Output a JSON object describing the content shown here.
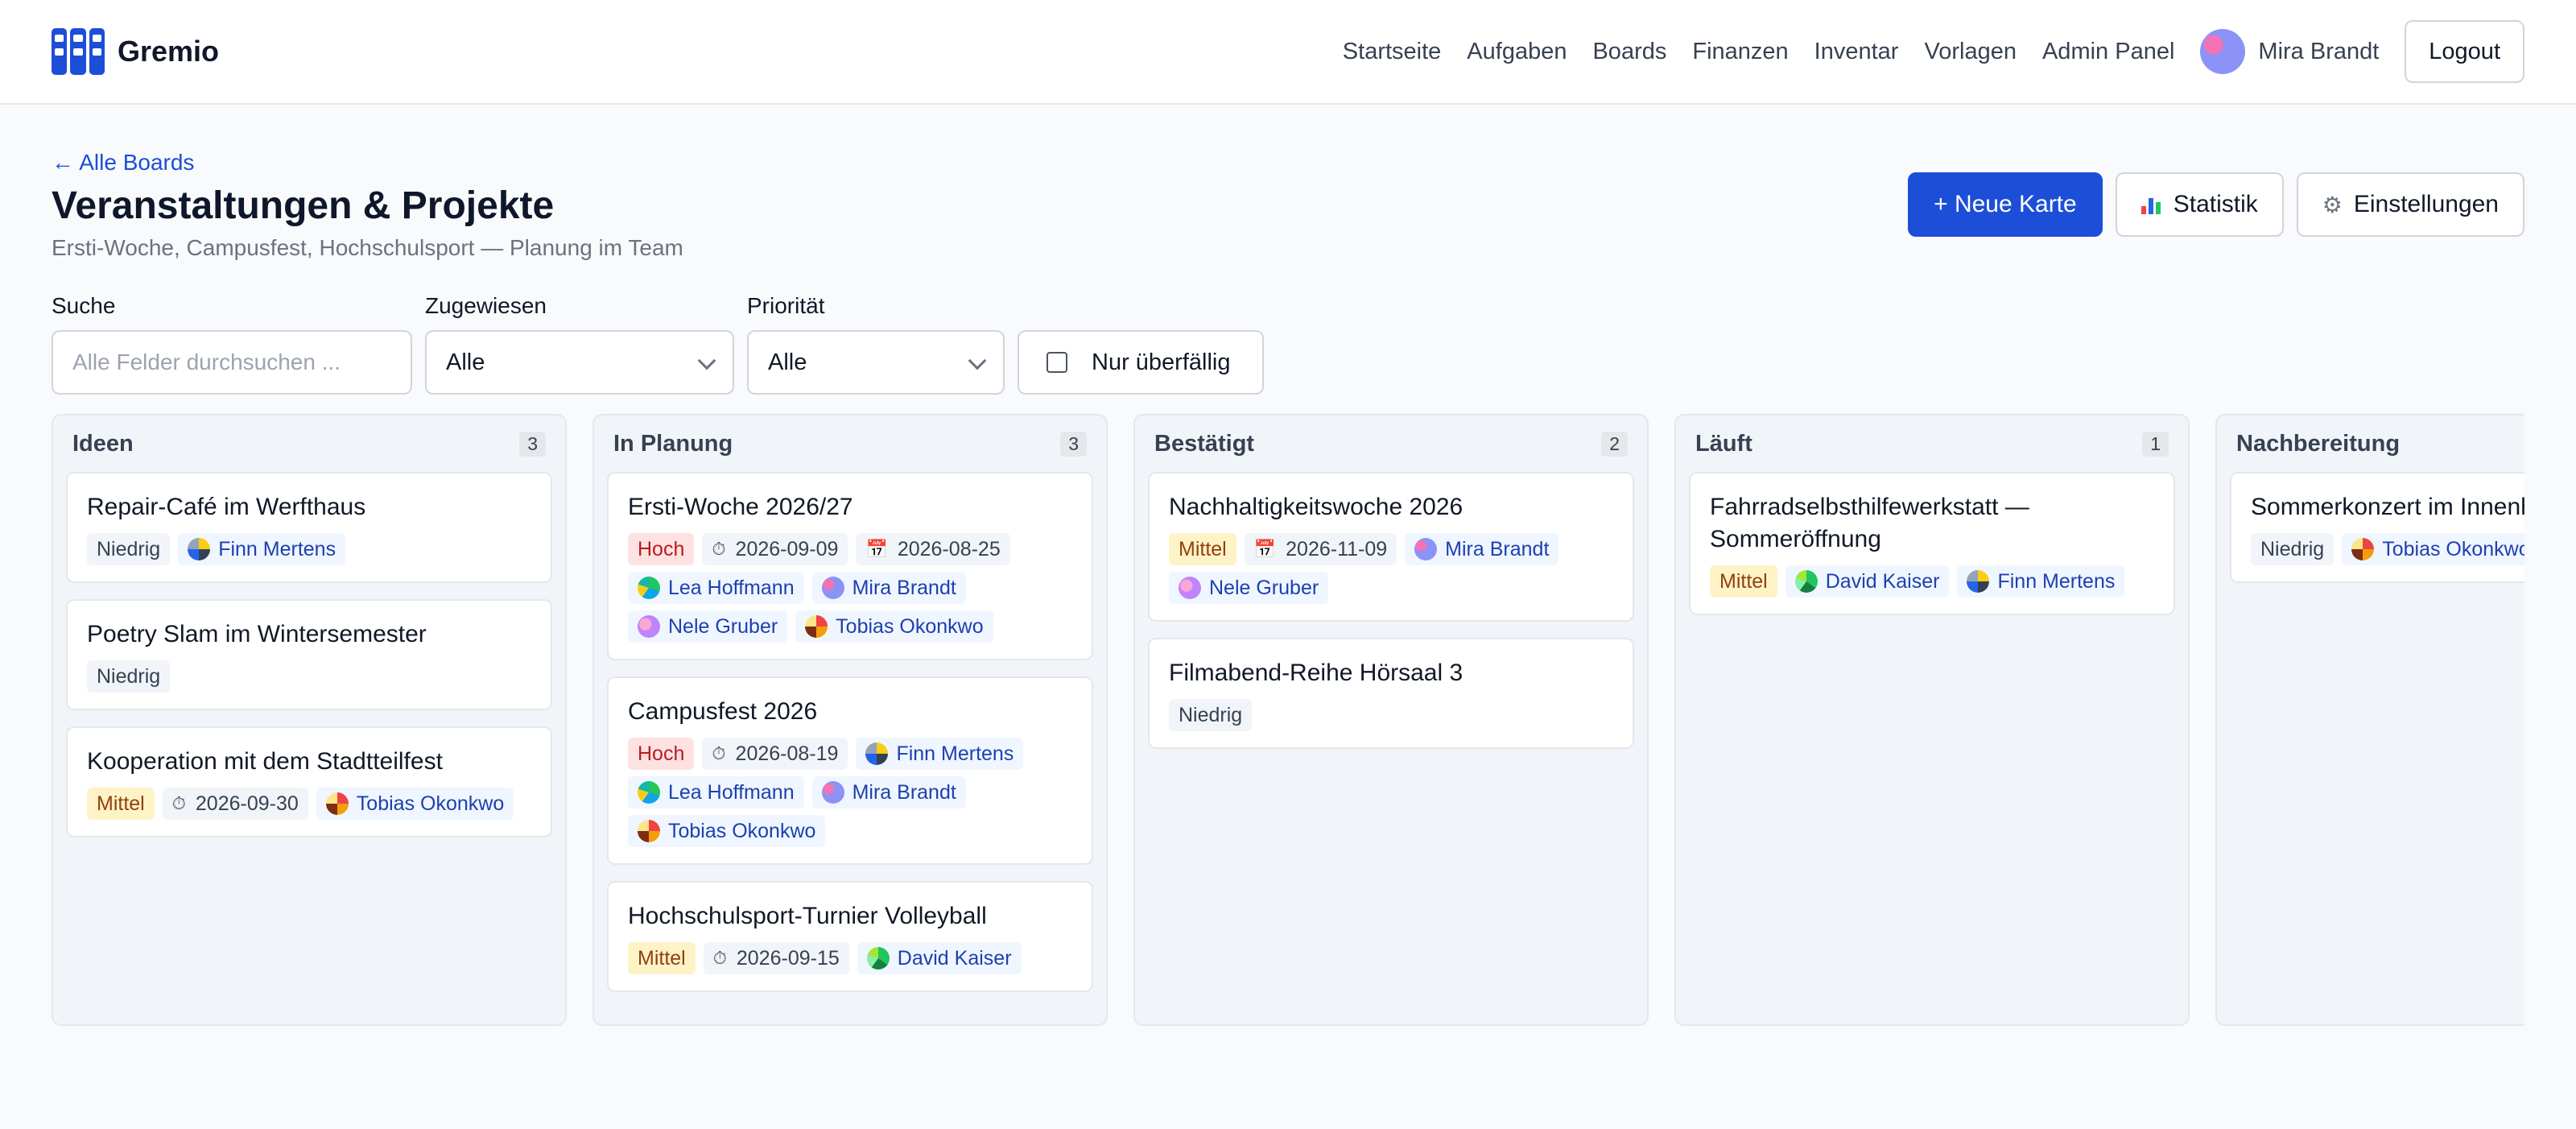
{
  "app": {
    "name": "Gremio"
  },
  "nav": {
    "links": [
      "Startseite",
      "Aufgaben",
      "Boards",
      "Finanzen",
      "Inventar",
      "Vorlagen",
      "Admin Panel"
    ],
    "user": "Mira Brandt",
    "logout": "Logout"
  },
  "page": {
    "back": "← Alle Boards",
    "title": "Veranstaltungen & Projekte",
    "subtitle": "Ersti-Woche, Campusfest, Hochschulsport — Planung im Team"
  },
  "actions": {
    "new_card": "+ Neue Karte",
    "stats": "Statistik",
    "settings": "Einstellungen"
  },
  "filters": {
    "search_label": "Suche",
    "search_placeholder": "Alle Felder durchsuchen ...",
    "assigned_label": "Zugewiesen",
    "assigned_value": "Alle",
    "priority_label": "Priorität",
    "priority_value": "Alle",
    "overdue_label": "Nur überfällig"
  },
  "colors": {
    "accent": "#1d4ed8",
    "column_bg": "#f1f5f9"
  },
  "icons": {
    "due": "timer-icon",
    "start": "calendar-icon"
  },
  "columns": [
    {
      "title": "Ideen",
      "count": "3",
      "cards": [
        {
          "title": "Repair-Café im Werfthaus",
          "priority": "Niedrig",
          "people": [
            "Finn Mertens"
          ]
        },
        {
          "title": "Poetry Slam im Wintersemester",
          "priority": "Niedrig",
          "people": []
        },
        {
          "title": "Kooperation mit dem Stadtteilfest",
          "priority": "Mittel",
          "due": "2026-09-30",
          "people": [
            "Tobias Okonkwo"
          ]
        }
      ]
    },
    {
      "title": "In Planung",
      "count": "3",
      "cards": [
        {
          "title": "Ersti-Woche 2026/27",
          "priority": "Hoch",
          "due": "2026-09-09",
          "start": "2026-08-25",
          "people": [
            "Lea Hoffmann",
            "Mira Brandt",
            "Nele Gruber",
            "Tobias Okonkwo"
          ]
        },
        {
          "title": "Campusfest 2026",
          "priority": "Hoch",
          "due": "2026-08-19",
          "people": [
            "Finn Mertens",
            "Lea Hoffmann",
            "Mira Brandt",
            "Tobias Okonkwo"
          ]
        },
        {
          "title": "Hochschulsport-Turnier Volleyball",
          "priority": "Mittel",
          "due": "2026-09-15",
          "people": [
            "David Kaiser"
          ]
        }
      ]
    },
    {
      "title": "Bestätigt",
      "count": "2",
      "cards": [
        {
          "title": "Nachhaltigkeitswoche 2026",
          "priority": "Mittel",
          "start": "2026-11-09",
          "people": [
            "Mira Brandt",
            "Nele Gruber"
          ]
        },
        {
          "title": "Filmabend-Reihe Hörsaal 3",
          "priority": "Niedrig",
          "people": []
        }
      ]
    },
    {
      "title": "Läuft",
      "count": "1",
      "cards": [
        {
          "title": "Fahrradselbsthilfewerkstatt — Sommeröffnung",
          "priority": "Mittel",
          "people": [
            "David Kaiser",
            "Finn Mertens"
          ]
        }
      ]
    },
    {
      "title": "Nachbereitung",
      "count": "",
      "cards": [
        {
          "title": "Sommerkonzert im Innenhof",
          "priority": "Niedrig",
          "people": [
            "Tobias Okonkwo"
          ]
        }
      ]
    }
  ]
}
